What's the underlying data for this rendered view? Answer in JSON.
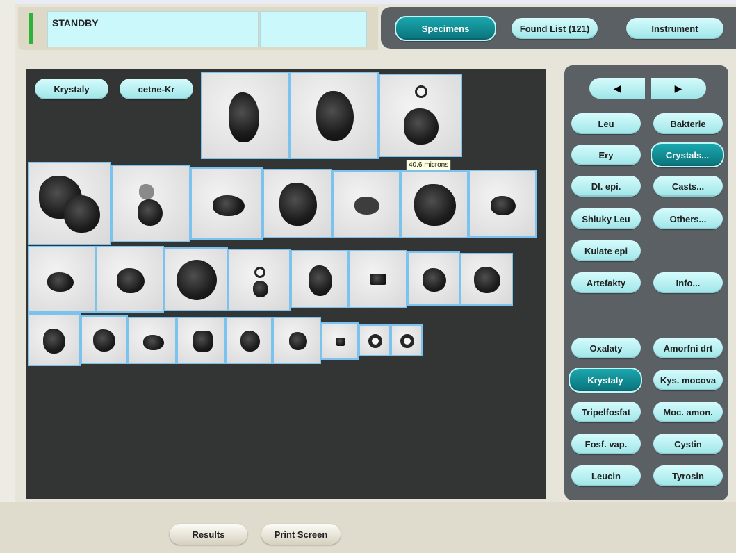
{
  "status": {
    "text": "STANDBY",
    "indicator_color": "#2db23a"
  },
  "nav": {
    "specimens": "Specimens",
    "found_list": "Found List (121)",
    "instrument": "Instrument"
  },
  "filters": {
    "category": "Krystaly",
    "sub": "cetne-Kr"
  },
  "tooltip": "40.6 microns",
  "sidebar": {
    "prev": "◀",
    "next": "▶",
    "main": [
      "Leu",
      "Bakterie",
      "Ery",
      "Crystals...",
      "Dl. epi.",
      "Casts...",
      "Shluky Leu",
      "Others...",
      "Kulate epi",
      "Artefakty",
      "Info..."
    ],
    "crystals": [
      "Oxalaty",
      "Amorfni drt",
      "Krystaly",
      "Kys. mocova",
      "Tripelfosfat",
      "Moc. amon.",
      "Fosf. vap.",
      "Cystin",
      "Leucin",
      "Tyrosin"
    ]
  },
  "bottom": {
    "results": "Results",
    "print": "Print Screen"
  },
  "colors": {
    "accent": "#0f8d95",
    "button": "#b7f0f2",
    "panel": "#5b6064",
    "image_area": "#333535",
    "thumb_border": "#7bc3ee"
  }
}
